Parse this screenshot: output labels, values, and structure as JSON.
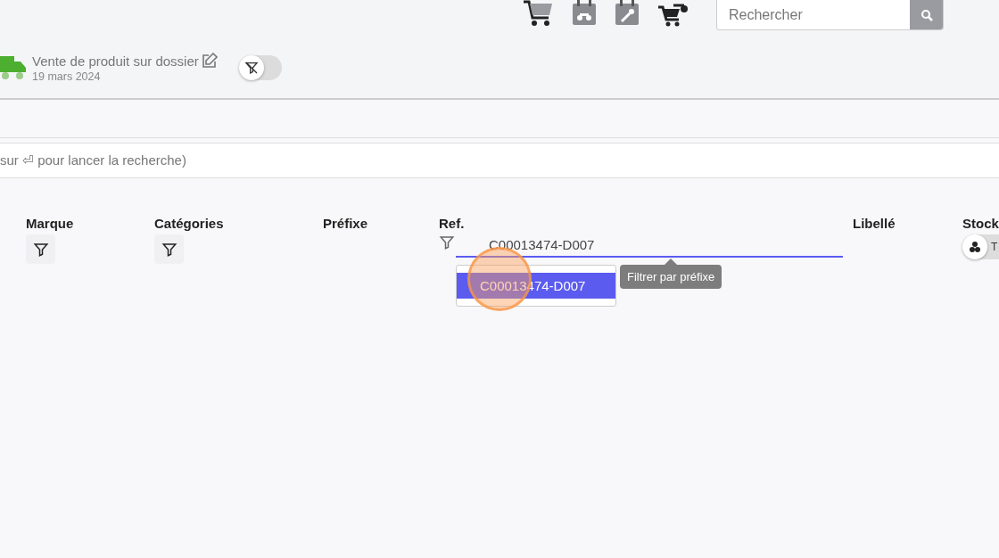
{
  "topbar": {
    "search": {
      "placeholder": "Rechercher"
    }
  },
  "document": {
    "title": "Vente de produit sur dossier",
    "date": "19 mars 2024",
    "filter_toggle": {
      "on": false
    }
  },
  "search_hint": "sur ⏎ pour lancer la recherche)",
  "columns": [
    {
      "label": "Marque",
      "kind": "filter-button"
    },
    {
      "label": "Catégories",
      "kind": "filter-button"
    },
    {
      "label": "Préfixe",
      "kind": "plain"
    },
    {
      "label": "Ref.",
      "kind": "ref-input",
      "value": "C00013474-D007",
      "suggestions": [
        {
          "label": "C00013474-D007",
          "selected": true
        }
      ],
      "tooltip": "Filtrer par préfixe"
    },
    {
      "label": "Libellé",
      "kind": "plain"
    },
    {
      "label": "Stock",
      "kind": "stock-toggle",
      "toggle_label": "T"
    }
  ]
}
